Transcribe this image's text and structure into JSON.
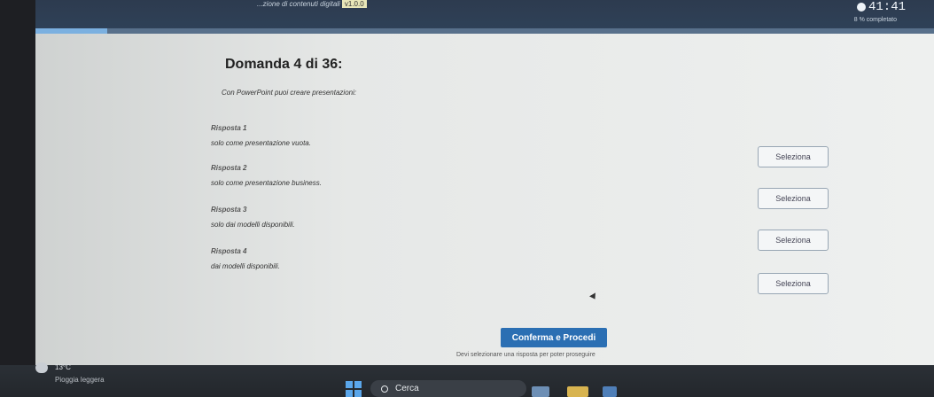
{
  "exam": {
    "title": "...zione di contenuti digitali",
    "version": "v1.0.0",
    "timer": "41:41",
    "progress_label": "8 % completato",
    "progress_fraction": 0.08
  },
  "question": {
    "heading": "Domanda 4 di 36:",
    "prompt": "Con PowerPoint puoi creare presentazioni:"
  },
  "answers": [
    {
      "number": "Risposta 1",
      "text": "solo come presentazione vuota.",
      "button": "Seleziona"
    },
    {
      "number": "Risposta 2",
      "text": "solo come presentazione business.",
      "button": "Seleziona"
    },
    {
      "number": "Risposta 3",
      "text": "solo dai modelli disponibili.",
      "button": "Seleziona"
    },
    {
      "number": "Risposta 4",
      "text": "dai modelli disponibili.",
      "button": "Seleziona"
    }
  ],
  "footer": {
    "confirm": "Conferma e Procedi",
    "hint": "Devi selezionare una risposta per poter proseguire"
  },
  "taskbar": {
    "temp": "13°C",
    "weather": "Pioggia leggera",
    "search": "Cerca"
  }
}
